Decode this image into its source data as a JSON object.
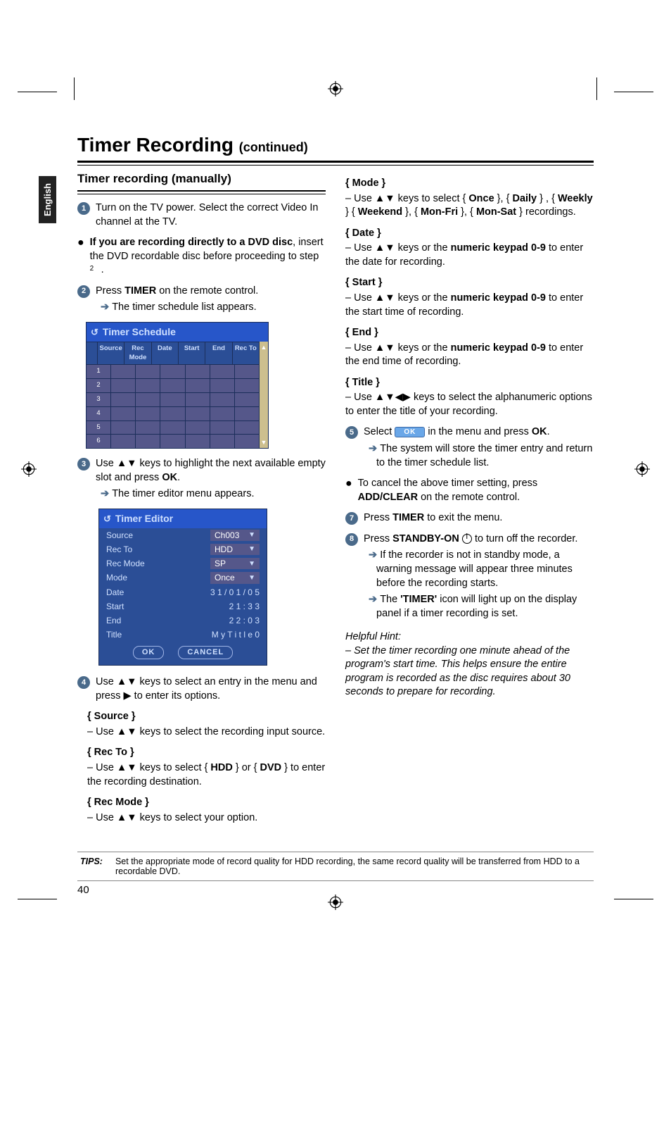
{
  "header": {
    "title": "Timer Recording",
    "continued": "(continued)"
  },
  "language_tab": "English",
  "section": {
    "title": "Timer recording (manually)"
  },
  "left": {
    "step1": "Turn on the TV power. Select the correct Video In channel at the TV.",
    "bullet1a": "If you are recording directly to a DVD disc",
    "bullet1b": ", insert the DVD recordable disc before proceeding to step ",
    "step2a": "Press ",
    "step2b": "TIMER",
    "step2c": " on the remote control.",
    "step2arrow": "The timer schedule list appears.",
    "sched_title": "Timer Schedule",
    "sched_cols": [
      "Source",
      "Rec Mode",
      "Date",
      "Start",
      "End",
      "Rec To"
    ],
    "step3a": "Use ▲▼ keys to highlight the next available empty slot and press ",
    "step3b": "OK",
    "step3c": ".",
    "step3arrow": "The timer editor menu appears.",
    "editor_title": "Timer Editor",
    "editor_rows": [
      {
        "label": "Source",
        "val": "Ch003",
        "dd": true
      },
      {
        "label": "Rec To",
        "val": "HDD",
        "dd": true
      },
      {
        "label": "Rec Mode",
        "val": "SP",
        "dd": true
      },
      {
        "label": "Mode",
        "val": "Once",
        "dd": true
      },
      {
        "label": "Date",
        "val": "3 1 / 0 1 / 0 5",
        "dd": false
      },
      {
        "label": "Start",
        "val": "2 1 : 3 3",
        "dd": false
      },
      {
        "label": "End",
        "val": "2 2 : 0 3",
        "dd": false
      },
      {
        "label": "Title",
        "val": "M y T i t l e 0",
        "dd": false
      }
    ],
    "editor_ok": "OK",
    "editor_cancel": "CANCEL",
    "step4": "Use ▲▼ keys to select an entry in the menu and press ▶ to enter its options.",
    "f_source_name": "{ Source }",
    "f_source_desc": "–  Use ▲▼ keys to select the recording input source.",
    "f_recto_name": "{ Rec To }",
    "f_recto_desc_a": "–  Use ▲▼ keys to select { ",
    "f_recto_desc_b": "HDD",
    "f_recto_desc_c": " } or { ",
    "f_recto_desc_d": "DVD",
    "f_recto_desc_e": " } to enter the recording destination.",
    "f_recmode_name": "{ Rec Mode }",
    "f_recmode_desc": "–  Use ▲▼ keys to select your option."
  },
  "right": {
    "f_mode_name": "{ Mode }",
    "f_mode_desc_a": "–  Use ▲▼ keys to select { ",
    "f_mode_once": "Once",
    "f_mode_mid": " }, { ",
    "f_mode_daily": "Daily",
    "f_mode_mid2": " } , { ",
    "f_mode_weekly": "Weekly",
    "f_mode_mid3": " } { ",
    "f_mode_weekend": "Weekend",
    "f_mode_mid4": " }, { ",
    "f_mode_monfri": "Mon-Fri",
    "f_mode_mid5": " }, { ",
    "f_mode_monsat": "Mon-Sat",
    "f_mode_end": " } recordings.",
    "f_date_name": "{ Date }",
    "f_date_desc_a": "–  Use ▲▼ keys or the ",
    "f_date_desc_b": "numeric keypad 0-9",
    "f_date_desc_c": " to enter the date for recording.",
    "f_start_name": "{ Start }",
    "f_start_desc_a": "–  Use ▲▼ keys or the ",
    "f_start_desc_b": "numeric keypad 0-9",
    "f_start_desc_c": " to enter the start time of recording.",
    "f_end_name": "{ End }",
    "f_end_desc_a": "–  Use ▲▼ keys or the ",
    "f_end_desc_b": "numeric keypad 0-9",
    "f_end_desc_c": " to enter the end time of recording.",
    "f_title_name": "{ Title }",
    "f_title_desc": "–  Use ▲▼◀▶ keys to select the alphanumeric options to enter the title of your recording.",
    "step5a": "Select ",
    "step5b": " in the menu and press ",
    "step5c": "OK",
    "step5d": ".",
    "step5arrow": "The system will store the timer entry and return to the timer schedule list.",
    "bullet6a": "To cancel the above timer setting, press ",
    "bullet6b": "ADD/CLEAR",
    "bullet6c": " on the remote control.",
    "step7a": "Press ",
    "step7b": "TIMER",
    "step7c": " to exit the menu.",
    "step8a": "Press ",
    "step8b": "STANDBY-ON",
    "step8c": " to turn off the recorder.",
    "step8arrow1": "If the recorder is not in standby mode, a warning message will appear three minutes before the recording starts.",
    "step8arrow2a": "The ",
    "step8arrow2b": "'TIMER'",
    "step8arrow2c": " icon will light up on the display panel if a timer recording is set.",
    "hint_label": "Helpful Hint:",
    "hint_text": "– Set the timer recording one minute ahead of the program's start time. This helps ensure the entire program is recorded as the disc requires about 30 seconds to prepare for recording."
  },
  "tips": {
    "label": "TIPS:",
    "text": "Set the appropriate mode of record quality for HDD recording, the same record quality will be transferred from HDD to a recordable DVD."
  },
  "page_number": "40",
  "ok_pill": "OK"
}
